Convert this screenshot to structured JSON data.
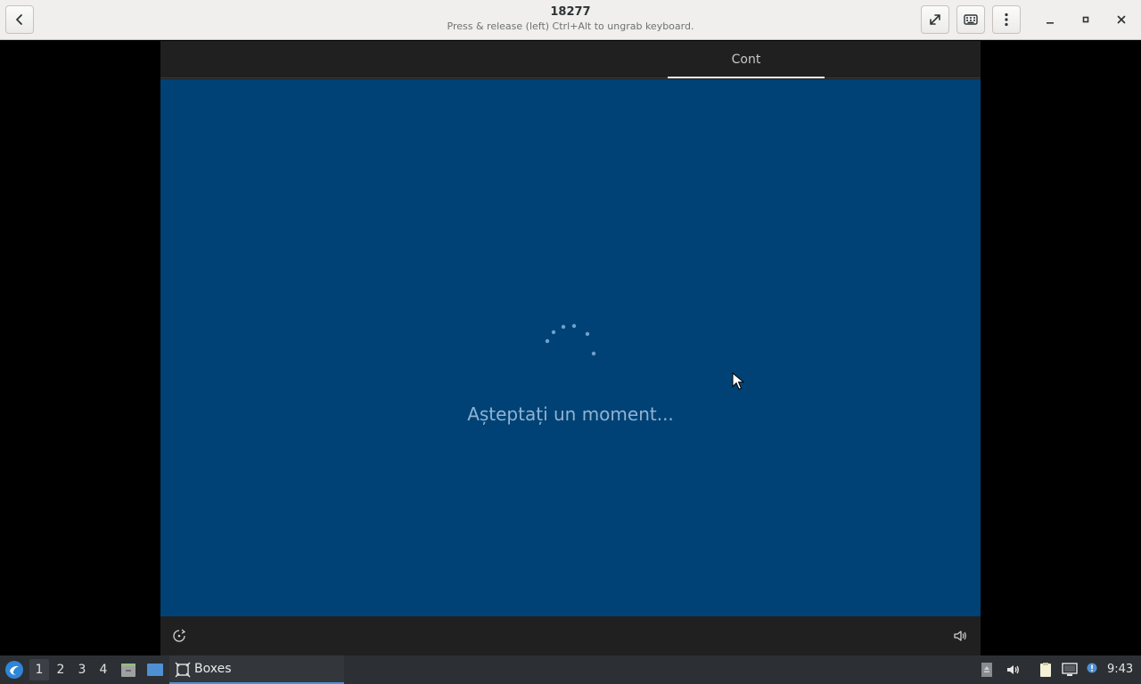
{
  "header": {
    "title": "18277",
    "subtitle": "Press & release (left) Ctrl+Alt to ungrab keyboard.",
    "icons": {
      "back": "back-arrow-icon",
      "fullscreen": "fullscreen-icon",
      "keyboard": "keyboard-icon",
      "menu": "kebab-menu-icon",
      "minimize": "minimize-icon",
      "maximize": "maximize-icon",
      "close": "close-icon"
    }
  },
  "vm": {
    "tab_label": "Cont",
    "wait_text": "Așteptați un moment...",
    "background_color": "#004275",
    "icons": {
      "accessibility": "ease-of-access-icon",
      "volume": "volume-icon",
      "spinner": "loading-spinner-icon",
      "cursor": "mouse-cursor-icon"
    }
  },
  "taskbar": {
    "workspaces": [
      "1",
      "2",
      "3",
      "4"
    ],
    "active_workspace": "1",
    "task_label": "Boxes",
    "clock": "9:43",
    "accent_color": "#4f8fd4",
    "icons": {
      "menu": "distro-menu-icon",
      "files": "file-manager-icon",
      "desktop": "show-desktop-icon",
      "boxes": "boxes-app-icon",
      "tray_1": "removable-drive-icon",
      "tray_2": "volume-icon",
      "tray_3": "clipboard-icon",
      "tray_4": "network-wired-icon",
      "tray_5": "notification-icon"
    }
  }
}
